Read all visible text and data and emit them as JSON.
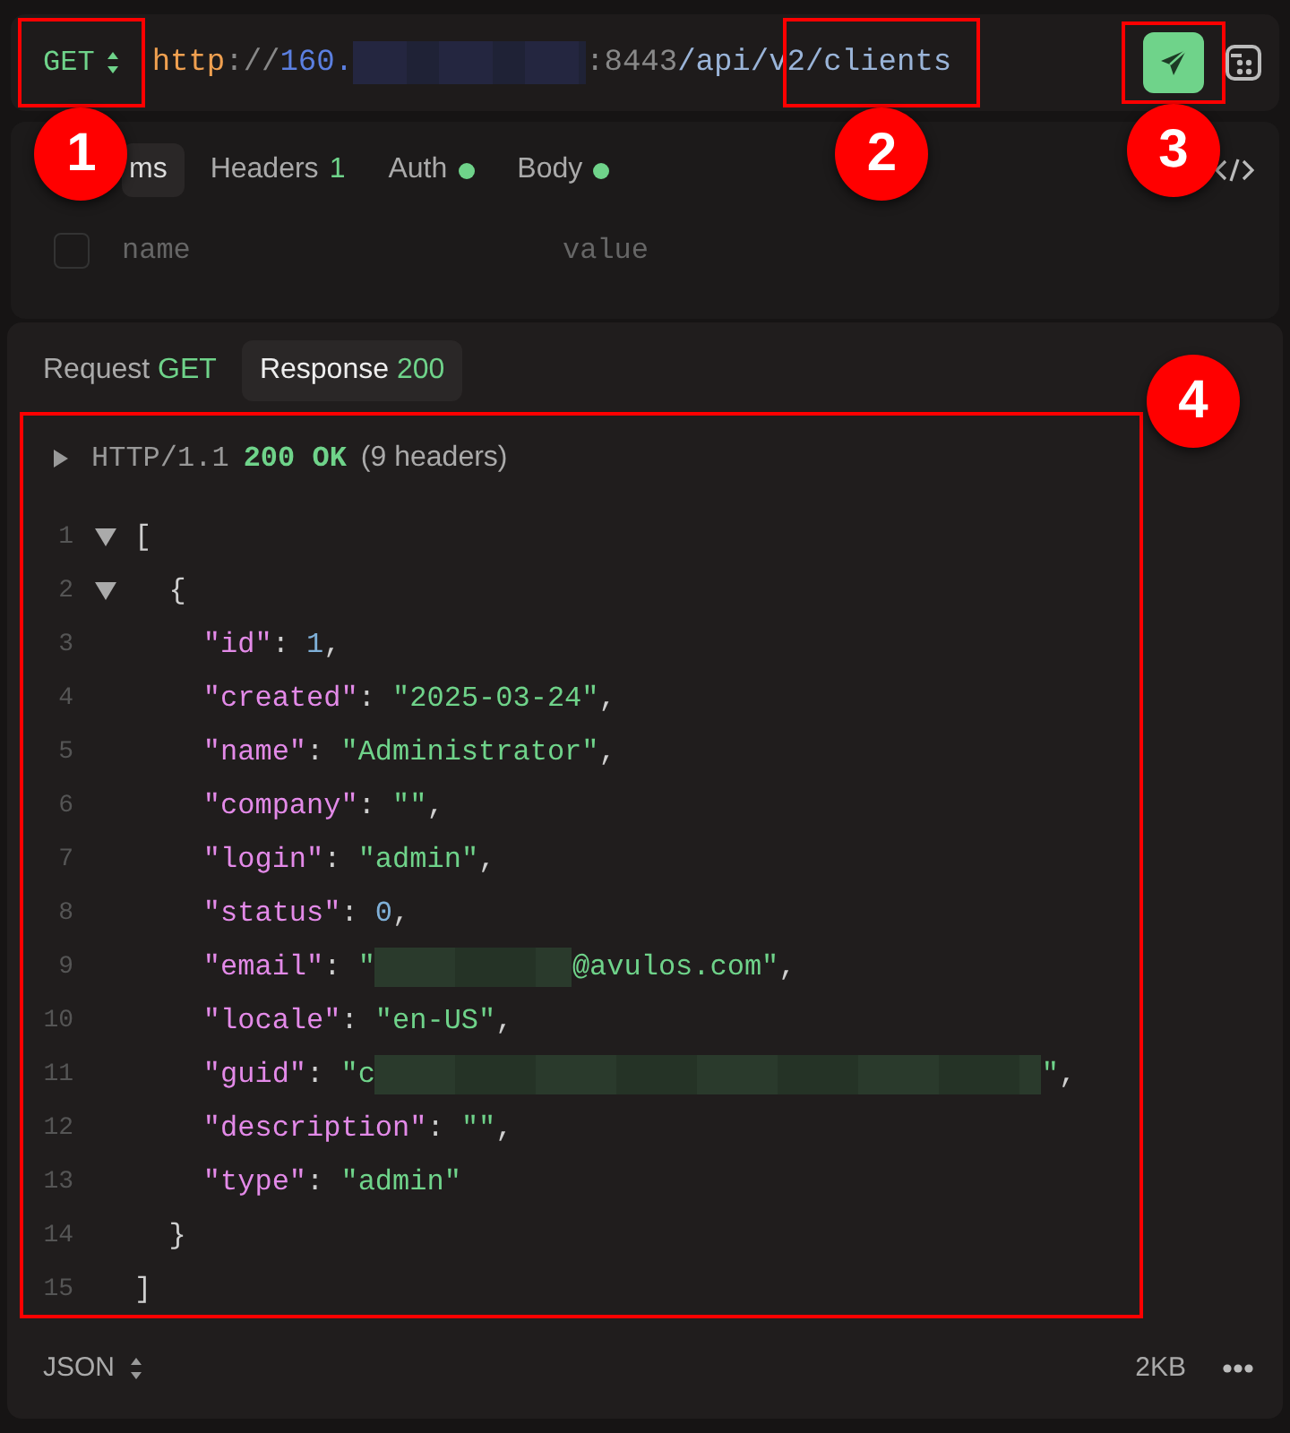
{
  "request": {
    "method": "GET",
    "method_callout": "1",
    "url_parts": [
      {
        "kind": "scheme",
        "text": "http"
      },
      {
        "kind": "sep",
        "text": "://"
      },
      {
        "kind": "host",
        "text": "160."
      },
      {
        "kind": "mask"
      },
      {
        "kind": "sep",
        "text": ":8443"
      },
      {
        "kind": "path",
        "text": "/api/v"
      },
      {
        "kind": "path",
        "text": "2/clients",
        "callout": "2"
      }
    ],
    "send_callout": "3"
  },
  "tabs": [
    {
      "label": "ms",
      "selected": true
    },
    {
      "label": "Headers",
      "badge": "1",
      "selected": false
    },
    {
      "label": "Auth",
      "dot": true,
      "selected": false
    },
    {
      "label": "Body",
      "dot": true,
      "selected": false
    }
  ],
  "params": {
    "checked": false,
    "name_placeholder": "name",
    "value_placeholder": "value"
  },
  "response_tabs": [
    {
      "label": "Request",
      "value": "GET",
      "selected": false
    },
    {
      "label": "Response",
      "value": "200",
      "selected": true
    }
  ],
  "response": {
    "callout": "4",
    "status_line": {
      "expanded": false,
      "protocol": "HTTP/1.1",
      "status": "200 OK",
      "headers": "(9 headers)"
    },
    "lines": [
      {
        "number": "1",
        "fold": true,
        "tokens": [
          {
            "kind": "punct",
            "text": "["
          }
        ]
      },
      {
        "number": "2",
        "fold": true,
        "tokens": [
          {
            "kind": "punct",
            "text": "  {"
          }
        ]
      },
      {
        "number": "3",
        "tokens": [
          {
            "kind": "key",
            "text": "    \"id\""
          },
          {
            "kind": "punct",
            "text": ": "
          },
          {
            "kind": "num",
            "text": "1"
          },
          {
            "kind": "punct",
            "text": ","
          }
        ]
      },
      {
        "number": "4",
        "tokens": [
          {
            "kind": "key",
            "text": "    \"created\""
          },
          {
            "kind": "punct",
            "text": ": "
          },
          {
            "kind": "str",
            "text": "\"2025-03-24\""
          },
          {
            "kind": "punct",
            "text": ","
          }
        ]
      },
      {
        "number": "5",
        "tokens": [
          {
            "kind": "key",
            "text": "    \"name\""
          },
          {
            "kind": "punct",
            "text": ": "
          },
          {
            "kind": "str",
            "text": "\"Administrator\""
          },
          {
            "kind": "punct",
            "text": ","
          }
        ]
      },
      {
        "number": "6",
        "tokens": [
          {
            "kind": "key",
            "text": "    \"company\""
          },
          {
            "kind": "punct",
            "text": ": "
          },
          {
            "kind": "str",
            "text": "\"\""
          },
          {
            "kind": "punct",
            "text": ","
          }
        ]
      },
      {
        "number": "7",
        "tokens": [
          {
            "kind": "key",
            "text": "    \"login\""
          },
          {
            "kind": "punct",
            "text": ": "
          },
          {
            "kind": "str",
            "text": "\"admin\""
          },
          {
            "kind": "punct",
            "text": ","
          }
        ]
      },
      {
        "number": "8",
        "tokens": [
          {
            "kind": "key",
            "text": "    \"status\""
          },
          {
            "kind": "punct",
            "text": ": "
          },
          {
            "kind": "num",
            "text": "0"
          },
          {
            "kind": "punct",
            "text": ","
          }
        ]
      },
      {
        "number": "9",
        "tokens": [
          {
            "kind": "key",
            "text": "    \"email\""
          },
          {
            "kind": "punct",
            "text": ": "
          },
          {
            "kind": "str",
            "text": "\""
          },
          {
            "kind": "mask-short"
          },
          {
            "kind": "str",
            "text": "@avulos.com\""
          },
          {
            "kind": "punct",
            "text": ","
          }
        ]
      },
      {
        "number": "10",
        "tokens": [
          {
            "kind": "key",
            "text": "    \"locale\""
          },
          {
            "kind": "punct",
            "text": ": "
          },
          {
            "kind": "str",
            "text": "\"en-US\""
          },
          {
            "kind": "punct",
            "text": ","
          }
        ]
      },
      {
        "number": "11",
        "tokens": [
          {
            "kind": "key",
            "text": "    \"guid\""
          },
          {
            "kind": "punct",
            "text": ": "
          },
          {
            "kind": "str",
            "text": "\"c"
          },
          {
            "kind": "mask-long"
          },
          {
            "kind": "str",
            "text": "\""
          },
          {
            "kind": "punct",
            "text": ","
          }
        ]
      },
      {
        "number": "12",
        "tokens": [
          {
            "kind": "key",
            "text": "    \"description\""
          },
          {
            "kind": "punct",
            "text": ": "
          },
          {
            "kind": "str",
            "text": "\"\""
          },
          {
            "kind": "punct",
            "text": ","
          }
        ]
      },
      {
        "number": "13",
        "tokens": [
          {
            "kind": "key",
            "text": "    \"type\""
          },
          {
            "kind": "punct",
            "text": ": "
          },
          {
            "kind": "str",
            "text": "\"admin\""
          }
        ]
      },
      {
        "number": "14",
        "tokens": [
          {
            "kind": "punct",
            "text": "  }"
          }
        ]
      },
      {
        "number": "15",
        "tokens": [
          {
            "kind": "punct",
            "text": "]"
          }
        ]
      }
    ]
  },
  "footer": {
    "format": "JSON",
    "size": "2KB"
  }
}
